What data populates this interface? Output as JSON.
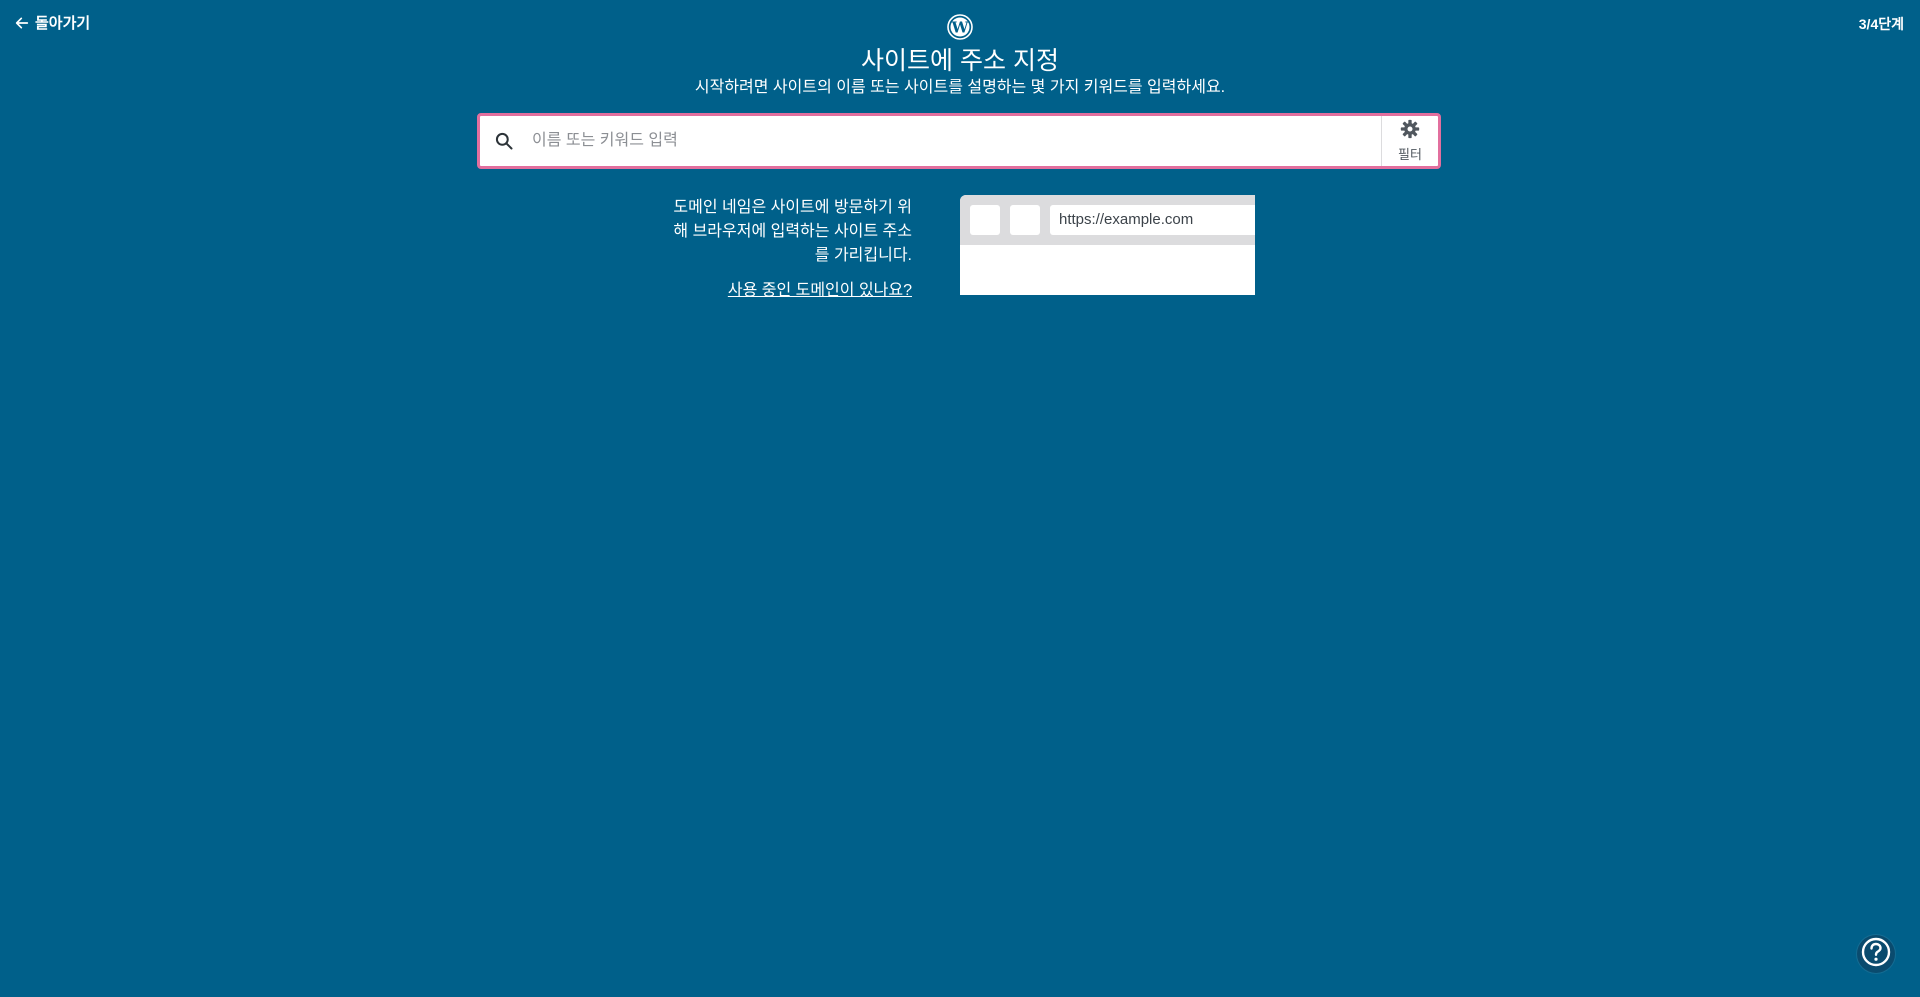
{
  "header": {
    "back_label": "돌아가기",
    "step_label": "3/4단계"
  },
  "main": {
    "title": "사이트에 주소 지정",
    "subtitle": "시작하려면 사이트의 이름 또는 사이트를 설명하는 몇 가지 키워드를 입력하세요."
  },
  "search": {
    "placeholder": "이름 또는 키워드 입력",
    "value": "",
    "filter_label": "필터"
  },
  "info": {
    "description": "도메인 네임은 사이트에 방문하기 위해 브라우저에 입력하는 사이트 주소를 가리킵니다.",
    "link_label": "사용 중인 도메인이 있나요?",
    "example_url": "https://example.com"
  },
  "colors": {
    "background": "#00608a",
    "search_border": "#e26f9e"
  },
  "icons": {
    "back": "arrow-left-icon",
    "logo": "wordpress-logo-icon",
    "search": "search-icon",
    "filter": "gear-icon",
    "help": "help-icon"
  }
}
